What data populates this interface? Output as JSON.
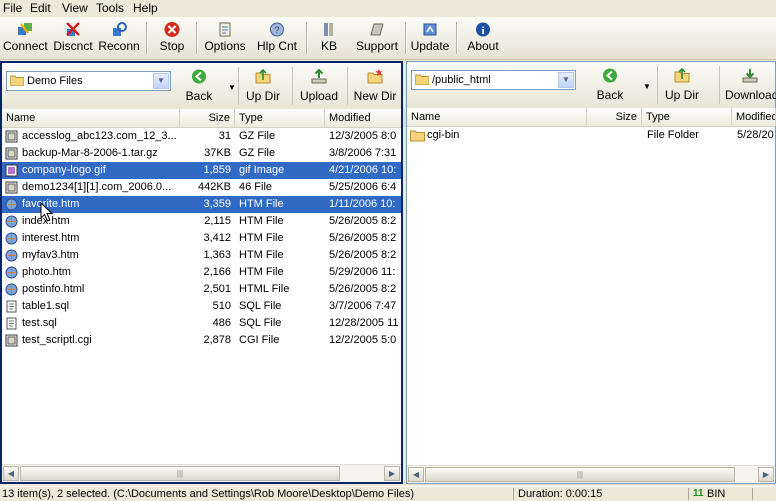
{
  "menu": [
    "File",
    "Edit",
    "View",
    "Tools",
    "Help"
  ],
  "toolbar": {
    "connect": "Connect",
    "disconnect": "Discnct",
    "reconnect": "Reconn",
    "stop": "Stop",
    "options": "Options",
    "help_contents": "Hlp Cnt",
    "kb": "KB",
    "support": "Support",
    "update": "Update",
    "about": "About"
  },
  "local": {
    "path": "Demo Files",
    "buttons": {
      "back": "Back",
      "up_dir": "Up Dir",
      "upload": "Upload",
      "new_dir": "New Dir"
    },
    "columns": {
      "name": "Name",
      "size": "Size",
      "type": "Type",
      "modified": "Modified"
    },
    "files": [
      {
        "name": "accesslog_abc123.com_12_3...",
        "size": "31",
        "type": "GZ File",
        "modified": "12/3/2005 8:0"
      },
      {
        "name": "backup-Mar-8-2006-1.tar.gz",
        "size": "37KB",
        "type": "GZ File",
        "modified": "3/8/2006 7:31"
      },
      {
        "name": "company-logo.gif",
        "size": "1,859",
        "type": "gif Image",
        "modified": "4/21/2006 10:"
      },
      {
        "name": "demo1234[1][1].com_2006.0...",
        "size": "442KB",
        "type": "46 File",
        "modified": "5/25/2006 6:4"
      },
      {
        "name": "favorite.htm",
        "size": "3,359",
        "type": "HTM File",
        "modified": "1/11/2006 10:"
      },
      {
        "name": "index.htm",
        "size": "2,115",
        "type": "HTM File",
        "modified": "5/26/2005 8:2"
      },
      {
        "name": "interest.htm",
        "size": "3,412",
        "type": "HTM File",
        "modified": "5/26/2005 8:2"
      },
      {
        "name": "myfav3.htm",
        "size": "1,363",
        "type": "HTM File",
        "modified": "5/26/2005 8:2"
      },
      {
        "name": "photo.htm",
        "size": "2,166",
        "type": "HTM File",
        "modified": "5/29/2006 11:"
      },
      {
        "name": "postinfo.html",
        "size": "2,501",
        "type": "HTML File",
        "modified": "5/26/2005 8:2"
      },
      {
        "name": "table1.sql",
        "size": "510",
        "type": "SQL File",
        "modified": "3/7/2006 7:47"
      },
      {
        "name": "test.sql",
        "size": "486",
        "type": "SQL File",
        "modified": "12/28/2005 11"
      },
      {
        "name": "test_scriptl.cgi",
        "size": "2,878",
        "type": "CGI File",
        "modified": "12/2/2005 5:0"
      }
    ]
  },
  "remote": {
    "path": "/public_html",
    "buttons": {
      "back": "Back",
      "up_dir": "Up Dir",
      "download": "Download"
    },
    "columns": {
      "name": "Name",
      "size": "Size",
      "type": "Type",
      "modified": "Modified"
    },
    "files": [
      {
        "name": "cgi-bin",
        "size": "",
        "type": "File Folder",
        "modified": "5/28/20"
      }
    ]
  },
  "status": {
    "items": "13 item(s), 2 selected.  (C:\\Documents and Settings\\Rob Moore\\Desktop\\Demo Files)",
    "duration": "Duration: 0:00:15",
    "mode": "BIN",
    "mode_prefix": "11"
  }
}
